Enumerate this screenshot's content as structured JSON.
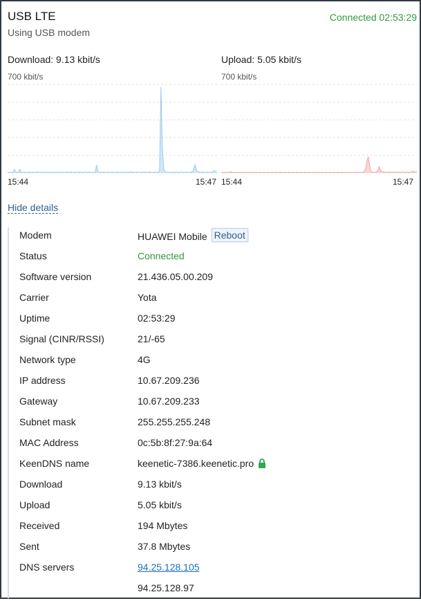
{
  "header": {
    "title": "USB LTE",
    "subtitle": "Using USB modem",
    "connection_status": "Connected 02:53:29"
  },
  "chart_data": [
    {
      "type": "area",
      "title": "Download: 9.13 kbit/s",
      "scale_label": "700 kbit/s",
      "x_start": "15:44",
      "x_end": "15:47",
      "ylim": [
        0,
        700
      ],
      "grid": true,
      "color": "#9ccbe8",
      "values": [
        5,
        3,
        6,
        4,
        5,
        28,
        6,
        5,
        4,
        28,
        5,
        4,
        6,
        5,
        4,
        5,
        6,
        4,
        5,
        4,
        6,
        5,
        8,
        5,
        4,
        6,
        5,
        4,
        5,
        6,
        4,
        5,
        6,
        5,
        4,
        5,
        6,
        5,
        4,
        6,
        5,
        4,
        5,
        6,
        4,
        5,
        6,
        5,
        4,
        5,
        6,
        5,
        4,
        6,
        5,
        4,
        5,
        6,
        4,
        5,
        8,
        5,
        4,
        6,
        5,
        62,
        8,
        5,
        4,
        6,
        5,
        4,
        5,
        6,
        4,
        5,
        6,
        5,
        4,
        5,
        6,
        5,
        4,
        6,
        5,
        4,
        5,
        6,
        4,
        5,
        8,
        6,
        5,
        4,
        6,
        5,
        4,
        5,
        4,
        8,
        6,
        5,
        4,
        5,
        6,
        5,
        4,
        5,
        6,
        5,
        4,
        20,
        680,
        220,
        30,
        8,
        6,
        5,
        4,
        5,
        6,
        5,
        4,
        6,
        5,
        4,
        5,
        6,
        5,
        4,
        6,
        5,
        4,
        5,
        8,
        6,
        35,
        65,
        18,
        8,
        5,
        4,
        6,
        5,
        4,
        5,
        6,
        5,
        4,
        6,
        8,
        18,
        10,
        8
      ]
    },
    {
      "type": "area",
      "title": "Upload: 5.05 kbit/s",
      "scale_label": "700 kbit/s",
      "x_start": "15:44",
      "x_end": "15:47",
      "ylim": [
        0,
        700
      ],
      "grid": true,
      "color": "#f2a4a4",
      "values": [
        4,
        3,
        5,
        4,
        3,
        5,
        4,
        10,
        5,
        4,
        3,
        5,
        4,
        3,
        5,
        4,
        3,
        5,
        4,
        3,
        5,
        4,
        3,
        5,
        4,
        3,
        5,
        4,
        3,
        5,
        4,
        3,
        5,
        4,
        3,
        5,
        4,
        3,
        5,
        4,
        3,
        5,
        4,
        3,
        5,
        4,
        3,
        5,
        4,
        3,
        5,
        4,
        3,
        5,
        4,
        3,
        5,
        4,
        3,
        5,
        4,
        3,
        5,
        4,
        3,
        5,
        4,
        3,
        5,
        4,
        3,
        5,
        4,
        3,
        5,
        4,
        3,
        5,
        4,
        3,
        5,
        4,
        3,
        5,
        4,
        3,
        5,
        4,
        3,
        5,
        4,
        3,
        5,
        4,
        3,
        5,
        4,
        3,
        5,
        4,
        3,
        5,
        4,
        3,
        5,
        4,
        10,
        35,
        90,
        130,
        60,
        12,
        6,
        5,
        4,
        8,
        16,
        50,
        22,
        10,
        8,
        6,
        5,
        4,
        6,
        5,
        4,
        5,
        6,
        5,
        4,
        6,
        5,
        4,
        5,
        6,
        5,
        4,
        6,
        5,
        4,
        8,
        12,
        9,
        6,
        8
      ]
    }
  ],
  "hide_details_label": "Hide details",
  "reboot_label": "Reboot",
  "details": [
    {
      "label": "Modem",
      "value": "HUAWEI Mobile"
    },
    {
      "label": "Status",
      "value": "Connected"
    },
    {
      "label": "Software version",
      "value": "21.436.05.00.209"
    },
    {
      "label": "Carrier",
      "value": "Yota"
    },
    {
      "label": "Uptime",
      "value": "02:53:29"
    },
    {
      "label": "Signal (CINR/RSSI)",
      "value": "21/-65"
    },
    {
      "label": "Network type",
      "value": "4G"
    },
    {
      "label": "IP address",
      "value": "10.67.209.236"
    },
    {
      "label": "Gateway",
      "value": "10.67.209.233"
    },
    {
      "label": "Subnet mask",
      "value": "255.255.255.248"
    },
    {
      "label": "MAC Address",
      "value": "0c:5b:8f:27:9a:64"
    },
    {
      "label": "KeenDNS name",
      "value": "keenetic-7386.keenetic.pro"
    },
    {
      "label": "Download",
      "value": "9.13 kbit/s"
    },
    {
      "label": "Upload",
      "value": "5.05 kbit/s"
    },
    {
      "label": "Received",
      "value": "194 Mbytes"
    },
    {
      "label": "Sent",
      "value": "37.8 Mbytes"
    },
    {
      "label": "DNS servers",
      "value": "94.25.128.105"
    },
    {
      "label": "",
      "value": "94.25.128.97"
    }
  ],
  "icons": {
    "keendns_lock": "lock-icon"
  },
  "colors": {
    "connected": "#2f9a3a",
    "link": "#1a6fc4",
    "lock": "#2fa84f"
  }
}
